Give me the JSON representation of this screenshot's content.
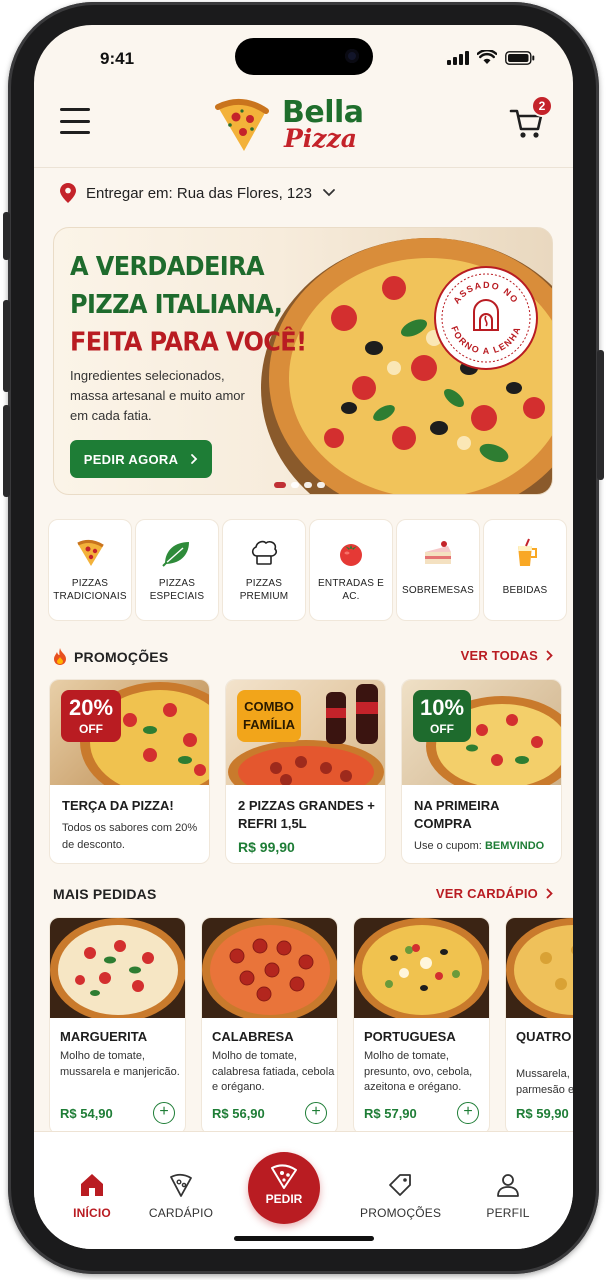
{
  "status_bar": {
    "time": "9:41"
  },
  "header": {
    "logo_word1": "Bella",
    "logo_word2": "Pizza",
    "cart_count": "2"
  },
  "address": {
    "label": "Entregar em: Rua das Flores, 123"
  },
  "hero": {
    "title_line1": "A VERDADEIRA",
    "title_line2": "PIZZA ITALIANA,",
    "title_line3": "FEITA PARA VOCÊ!",
    "subtitle": "Ingredientes selecionados, massa artesanal e muito amor em cada fatia.",
    "cta": "PEDIR AGORA",
    "seal_text_top": "ASSADO NO",
    "seal_text_bottom": "FORNO A LENHA"
  },
  "categories": [
    {
      "label": "PIZZAS TRADICIONAIS",
      "icon": "pizza-slice-icon"
    },
    {
      "label": "PIZZAS ESPECIAIS",
      "icon": "basil-leaf-icon"
    },
    {
      "label": "PIZZAS PREMIUM",
      "icon": "chef-hat-icon"
    },
    {
      "label": "ENTRADAS E AC.",
      "icon": "tomato-icon"
    },
    {
      "label": "SOBREMESAS",
      "icon": "cake-slice-icon"
    },
    {
      "label": "BEBIDAS",
      "icon": "drink-icon"
    }
  ],
  "promotions": {
    "title": "PROMOÇÕES",
    "see_all": "VER TODAS",
    "items": [
      {
        "badge_big": "20%",
        "badge_small": "OFF",
        "title": "TERÇA DA PIZZA!",
        "desc": "Todos os sabores com 20% de desconto.",
        "badge_color": "#b91c22"
      },
      {
        "badge_big": "COMBO",
        "badge_small": "FAMÍLIA",
        "title": "2 PIZZAS GRANDES + REFRI 1,5L",
        "price": "R$ 99,90",
        "badge_color": "#f2a51a"
      },
      {
        "badge_big": "10%",
        "badge_small": "OFF",
        "title": "NA PRIMEIRA COMPRA",
        "desc_prefix": "Use o cupom:",
        "coupon": "BEMVINDO",
        "badge_color": "#1e6b2d"
      }
    ]
  },
  "most_ordered": {
    "title": "MAIS PEDIDAS",
    "see_menu": "VER CARDÁPIO",
    "items": [
      {
        "name": "MARGUERITA",
        "desc": "Molho de tomate, mussarela e manjericão.",
        "price": "R$ 54,90"
      },
      {
        "name": "CALABRESA",
        "desc": "Molho de tomate, calabresa fatiada, cebola e orégano.",
        "price": "R$ 56,90"
      },
      {
        "name": "PORTUGUESA",
        "desc": "Molho de tomate, presunto, ovo, cebola, azeitona e orégano.",
        "price": "R$ 57,90"
      },
      {
        "name": "QUATRO QUEIJOS",
        "desc": "Mussarela, gorgonzola, parmesão e mussarela.",
        "price": "R$ 59,90"
      }
    ]
  },
  "bottom_nav": {
    "home": "INÍCIO",
    "menu": "CARDÁPIO",
    "order": "PEDIR",
    "promos": "PROMOÇÕES",
    "profile": "PERFIL"
  },
  "colors": {
    "brand_red": "#b91c22",
    "brand_green": "#1e6b2d",
    "background": "#fbf6ef"
  }
}
